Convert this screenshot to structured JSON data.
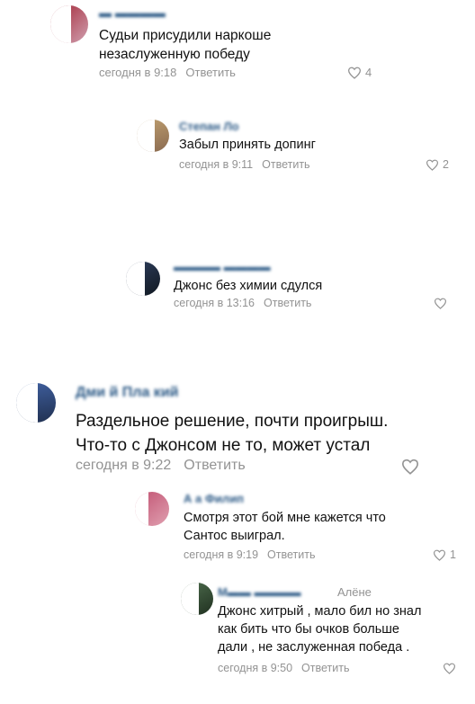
{
  "comments": [
    {
      "author": "",
      "text": "Судьи присудили наркоше\nнезаслуженную победу",
      "time": "сегодня в 9:18",
      "reply": "Ответить",
      "likes": "4"
    },
    {
      "author": "Степан Ло",
      "text": "Забыл принять допинг",
      "time": "сегодня в 9:11",
      "reply": "Ответить",
      "likes": "2"
    },
    {
      "author": "",
      "text": "Джонс без химии сдулся",
      "time": "сегодня в 13:16",
      "reply": "Ответить",
      "likes": ""
    },
    {
      "author": "Дми      й  Пла          кий",
      "text": "Раздельное решение, почти проигрыш.\nЧто-то с Джонсом не то, может устал",
      "time": "сегодня в 9:22",
      "reply": "Ответить",
      "likes": ""
    },
    {
      "author": "А       а Филип",
      "text": "Смотря этот бой мне кажется что\nСантос выиграл.",
      "time": "сегодня в 9:19",
      "reply": "Ответить",
      "likes": "1"
    },
    {
      "author": "М                    ",
      "reply_to": "Алёне",
      "text": "Джонс хитрый , мало бил но знал\nкак бить что бы очков больше\nдали , не заслуженная победа .",
      "time": "сегодня в 9:50",
      "reply": "Ответить",
      "likes": ""
    }
  ],
  "colors": {
    "author": "#2a5885",
    "meta": "#939393",
    "text": "#111111"
  },
  "icons": {
    "like": "heart-icon"
  }
}
